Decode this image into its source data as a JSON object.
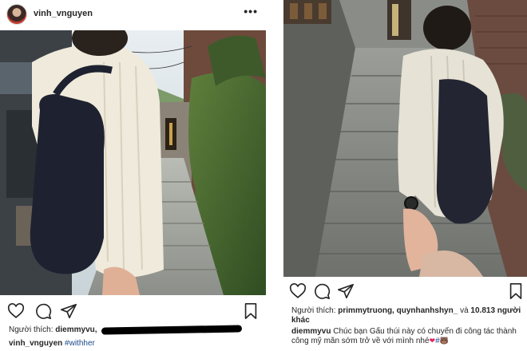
{
  "left_post": {
    "username": "vinh_vnguyen",
    "more_label": "•••",
    "likes_prefix": "Người thích:",
    "liked_by": "diemmyvu,",
    "caption_user": "vinh_vnguyen",
    "caption_hashtag": "#withher"
  },
  "right_post": {
    "likes_prefix": "Người thích:",
    "liked_by": "primmytruong, quynhanhshyn_",
    "likes_connector": "và",
    "likes_count": "10.813",
    "likes_suffix": "người khác",
    "caption_user": "diemmyvu",
    "caption_text": "Chúc bạn Gấu thúi này có chuyến đi công tác thành công mỹ mãn sớm trở về với mình nhé",
    "caption_heart": "❤",
    "caption_hashtag": "#",
    "caption_bear": "🐻"
  },
  "icons": {
    "heart": "heart-icon",
    "comment": "comment-icon",
    "share": "share-icon",
    "bookmark": "bookmark-icon",
    "more": "more-icon"
  },
  "colors": {
    "text": "#262626",
    "hashtag": "#1a4a8a",
    "heart_emoji": "#e0245e"
  }
}
